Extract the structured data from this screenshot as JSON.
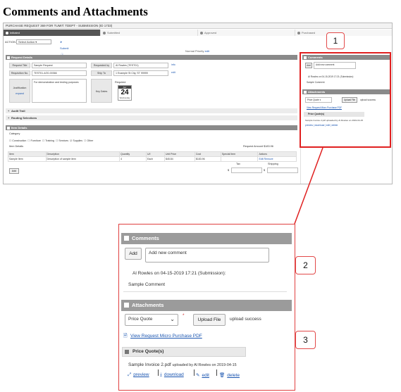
{
  "page_title": "Comments and Attachments",
  "screenshot": {
    "request_header": "PURCHASE REQUEST 369 FOR TUMIT: TDEPT - SUBMISSION (ID 1733)",
    "steps": [
      "Initiated",
      "Submitted",
      "Approved",
      "Purchased"
    ],
    "action_label": "ACTION",
    "action_value": "Select Action",
    "submit_label": "Submit",
    "normal_priority": "Normal Priority",
    "edit_label": "edit",
    "request_details_header": "Request Details",
    "fields": {
      "request_title_label": "Request Title",
      "request_title_value": "Sample Request",
      "requested_by_label": "Requested by",
      "requested_by_value": "Al Rowles (TEST01)",
      "requisition_no_label": "Requisition No.",
      "requisition_no_value": "TEST01-4/20-00366",
      "ship_to_label": "Ship To",
      "ship_to_value": "1 Example St City, ST 99999",
      "justification_label": "Justification",
      "justification_value": "For demonstration and testing purposes",
      "expand_label": "expand",
      "key_dates_label": "Key Dates",
      "required_label": "Required",
      "cal_month": "Apr",
      "cal_day": "24",
      "cal_weekday": "Wednesday",
      "info_label": "info"
    },
    "audit_trail": "Audit Trail",
    "routing_selections": "Routing Selections",
    "item_details_header": "Item Details",
    "category_label": "Category",
    "categories": [
      "Construction",
      "Furniture",
      "Training",
      "Services",
      "Supplies",
      "Other"
    ],
    "item_details_label": "Item Details",
    "request_amount_label": "Request Amount",
    "request_amount_value": "$183.96",
    "table_headers": [
      "Item",
      "Description",
      "Quantity",
      "U/I",
      "Unit Price",
      "Cost",
      "Special Item",
      "Actions"
    ],
    "table_row": [
      "Sample Item",
      "Description of sample item",
      "4",
      "Each",
      "$45.84",
      "$183.96",
      "",
      ""
    ],
    "row_edit": "Edit",
    "row_remove": "Remove",
    "add_button": "Add",
    "tax_label": "Tax",
    "shipping_label": "Shipping",
    "currency_symbol": "$",
    "comments_header": "Comments",
    "attachments_header": "Attachments"
  },
  "callouts": [
    "1",
    "2",
    "3"
  ],
  "comments": {
    "header": "Comments",
    "add_button": "Add",
    "input_placeholder": "Add new comment",
    "meta": "Al Rowles on 04-15-2019 17:21 (Submission):",
    "body": "Sample Comment"
  },
  "attachments": {
    "header": "Attachments",
    "doc_type": "Price Quote",
    "required_mark": "*",
    "upload_button": "Upload File",
    "upload_status": "upload success",
    "view_link": "View Request Micro Purchase PDF",
    "subheader": "Price Quote(s)",
    "file_name": "Sample Invoice 2.pdf",
    "uploaded_by": "uploaded by Al Rowles on 2019-04-15",
    "actions": [
      "preview",
      "download",
      "edit",
      "delete"
    ]
  },
  "colors": {
    "callout_border": "#e24a4a",
    "highlight_box": "#e02020",
    "section_header": "#9b9b9b",
    "link": "#1a55b0"
  }
}
